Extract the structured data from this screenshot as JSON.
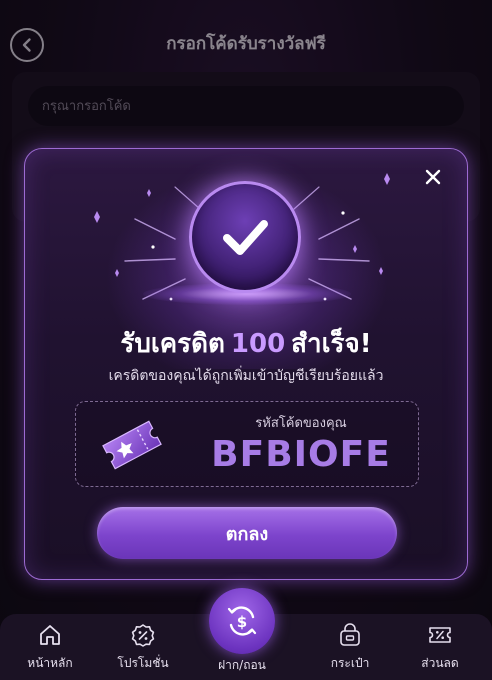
{
  "header": {
    "title": "กรอกโค้ดรับรางวัลฟรี",
    "back_icon": "chevron-left-icon"
  },
  "code_form": {
    "placeholder": "กรุณากรอกโค้ด"
  },
  "modal": {
    "title_prefix": "รับเครดิต",
    "amount": "100",
    "title_suffix": "สำเร็จ!",
    "subtitle": "เครดิตของคุณได้ถูกเพิ่มเข้าบัญชีเรียบร้อยแล้ว",
    "code_label": "รหัสโค้ดของคุณ",
    "code_value": "BFBIOFE",
    "confirm_label": "ตกลง",
    "close_icon": "close-icon",
    "badge_icon": "checkmark-icon",
    "ticket_icon": "ticket-icon"
  },
  "bottom_nav": {
    "items": [
      {
        "label": "หน้าหลัก",
        "icon": "home-icon"
      },
      {
        "label": "โปรโมชั่น",
        "icon": "promotion-icon"
      },
      {
        "label": "ฝาก/ถอน",
        "icon": "deposit-withdraw-icon"
      },
      {
        "label": "กระเป๋า",
        "icon": "wallet-icon"
      },
      {
        "label": "ส่วนลด",
        "icon": "discount-icon"
      }
    ]
  },
  "colors": {
    "accent": "#8b4fd6",
    "accent_light": "#c99bff",
    "background": "#0f0a14"
  }
}
